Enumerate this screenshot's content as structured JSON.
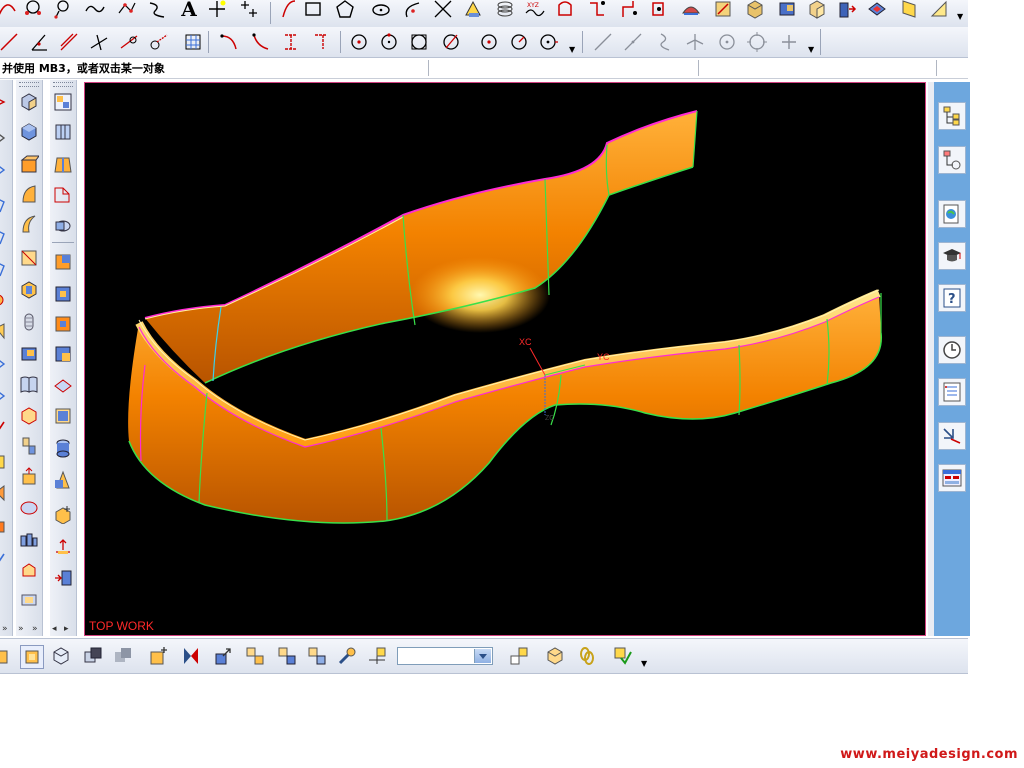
{
  "cue_line": {
    "text": "并使用 MB3，或者双击某一对象"
  },
  "viewport": {
    "view_label": "TOP WORK",
    "background": "#000000"
  },
  "wcs": {
    "x_label": "XC",
    "y_label": "YC",
    "z_label": "ZC"
  },
  "watermark": "www.meiyadesign.com",
  "toolbar_top": {
    "text_tool_glyph": "A"
  },
  "colors": {
    "surface": "#ff8a00",
    "edge_green": "#39e04a",
    "edge_magenta": "#ff2bd4",
    "resource_bar": "#6da7de",
    "label_red": "#ff2a2a"
  },
  "icons": {
    "row1": [
      "arc-icon",
      "spline-icon",
      "curve-icon",
      "wave-curve-icon",
      "point-set-icon",
      "helix-icon",
      "text-icon",
      "point-icon",
      "points-icon",
      "line-icon",
      "rectangle-icon",
      "polygon-icon",
      "ellipse-icon",
      "conic-icon",
      "intersect-curve-icon",
      "extract-icon",
      "spring-icon",
      "law-curve-icon",
      "offset-icon",
      "bridge-icon",
      "project-icon",
      "join-icon",
      "wrap-icon",
      "sketch-icon",
      "box-icon",
      "cylinder-icon",
      "sweep-icon",
      "fold-icon",
      "dropdown-icon"
    ],
    "row2": [
      "line-segment-icon",
      "angle-line-icon",
      "tangent-line-icon",
      "perpendicular-line-icon",
      "chain-line-icon",
      "arc-line-icon",
      "grid-icon",
      "arc-tangent-icon",
      "bezier-icon",
      "bracket-icon",
      "hook-icon",
      "circle-center-icon",
      "circle-point-icon",
      "circle-square-icon",
      "circle-slash-icon",
      "circle-dot-icon",
      "circle-clock-icon",
      "circle-arrow-icon",
      "dropdown-icon",
      "diag-line-icon",
      "slash-line-icon",
      "curve-fit-icon",
      "perp-icon",
      "circle-plus-icon",
      "crosshair-icon",
      "plus-icon",
      "dropdown-icon"
    ],
    "resource_bar": [
      "assembly-navigator-icon",
      "part-navigator-icon",
      "web-browser-icon",
      "training-icon",
      "help-icon",
      "history-icon",
      "system-materials-icon",
      "process-studio-icon",
      "roles-icon"
    ]
  }
}
